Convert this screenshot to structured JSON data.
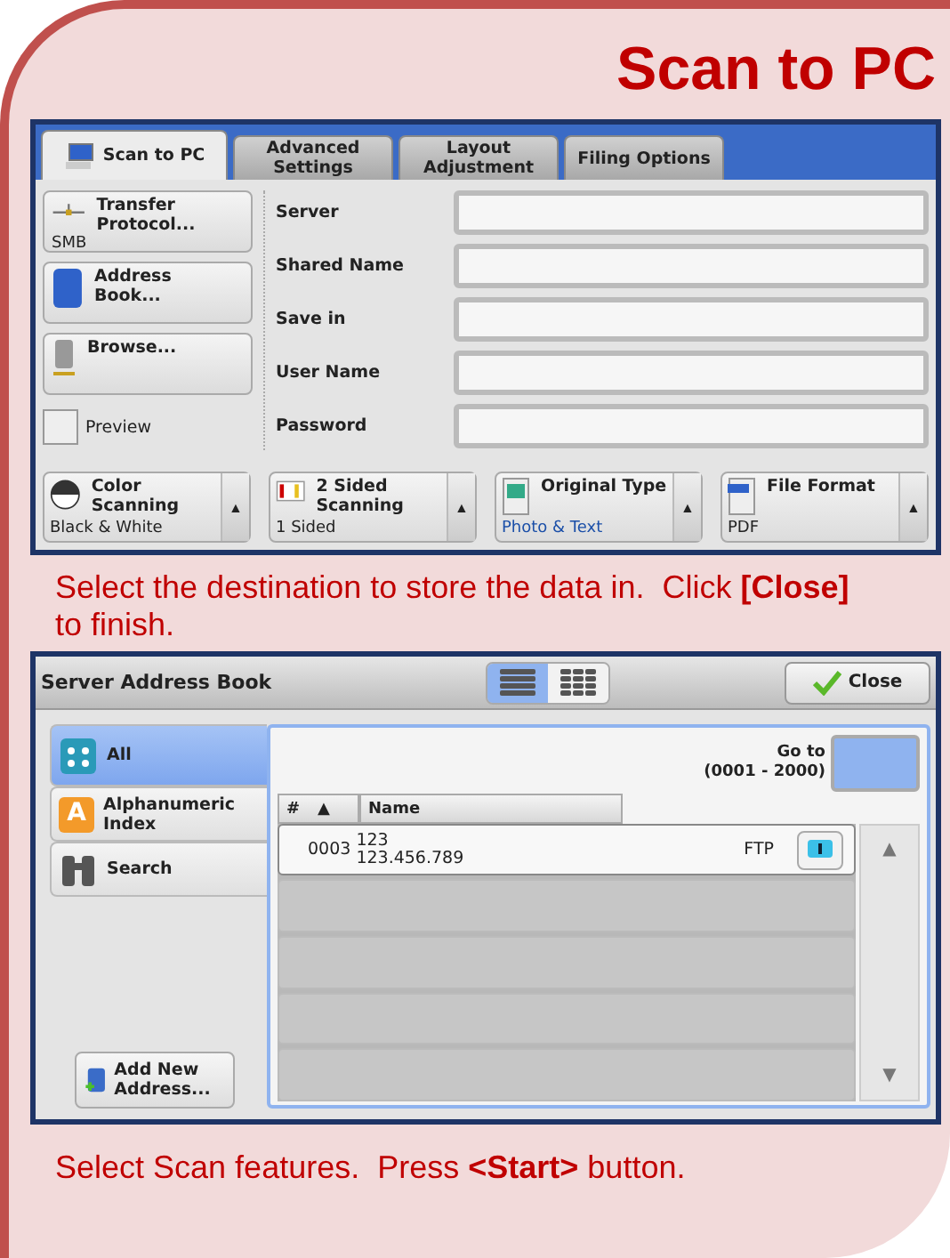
{
  "title": "Scan to PC",
  "scan_screen": {
    "tabs": [
      {
        "label": "Scan to PC",
        "selected": true
      },
      {
        "label": "Advanced Settings",
        "selected": false
      },
      {
        "label": "Layout Adjustment",
        "selected": false
      },
      {
        "label": "Filing Options",
        "selected": false
      }
    ],
    "side_controls": [
      {
        "kind": "button",
        "label": "Transfer Protocol...",
        "value": "SMB"
      },
      {
        "kind": "button",
        "label": "Address Book..."
      },
      {
        "kind": "button",
        "label": "Browse..."
      },
      {
        "kind": "checkbox",
        "label": "Preview",
        "checked": false
      }
    ],
    "fields": [
      {
        "label": "Server"
      },
      {
        "label": "Shared Name"
      },
      {
        "label": "Save in"
      },
      {
        "label": "User Name"
      },
      {
        "label": "Password"
      }
    ],
    "features": [
      {
        "label": "Color Scanning",
        "value": "Black & White",
        "value_highlight": false
      },
      {
        "label": "2 Sided Scanning",
        "value": "1 Sided",
        "value_highlight": false
      },
      {
        "label": "Original Type",
        "value": "Photo & Text",
        "value_highlight": true
      },
      {
        "label": "File Format",
        "value": "PDF",
        "value_highlight": false
      }
    ]
  },
  "instruction_1": "Select the destination to store the data in.  Click **[Close]** to finish.",
  "address_book": {
    "title": "Server Address Book",
    "view_modes": [
      {
        "kind": "list",
        "selected": true
      },
      {
        "kind": "grid",
        "selected": false
      }
    ],
    "close": "Close",
    "categories": [
      {
        "label": "All",
        "selected": true
      },
      {
        "label": "Alphanumeric Index",
        "selected": false
      },
      {
        "label": "Search",
        "selected": false
      }
    ],
    "letter_glyph": "A",
    "add_button": "Add New Address...",
    "goto_label": "Go to",
    "goto_range": "(0001 - 2000)",
    "columns": [
      "#",
      "Name"
    ],
    "sort_arrow": "▲",
    "rows": [
      {
        "number": "0003",
        "name": "123",
        "address": "123.456.789",
        "protocol": "FTP"
      }
    ],
    "scroll_up": "▲",
    "scroll_down": "▼"
  },
  "instruction_2": "Select Scan features.  Press **<Start>** button."
}
